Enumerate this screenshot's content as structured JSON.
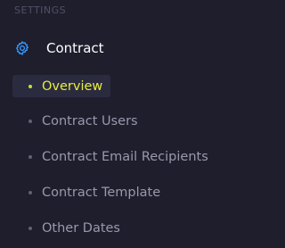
{
  "section": {
    "header": "SETTINGS"
  },
  "menu": {
    "parent": {
      "label": "Contract",
      "icon": "gear-icon"
    },
    "items": [
      {
        "label": "Overview",
        "active": true
      },
      {
        "label": "Contract Users",
        "active": false
      },
      {
        "label": "Contract Email Recipients",
        "active": false
      },
      {
        "label": "Contract Template",
        "active": false
      },
      {
        "label": "Other Dates",
        "active": false
      }
    ]
  },
  "colors": {
    "background": "#1e1e2d",
    "active_text": "#e8ee3c",
    "active_bg": "#2b2b40",
    "icon": "#3699ff",
    "text": "#9899ac"
  }
}
